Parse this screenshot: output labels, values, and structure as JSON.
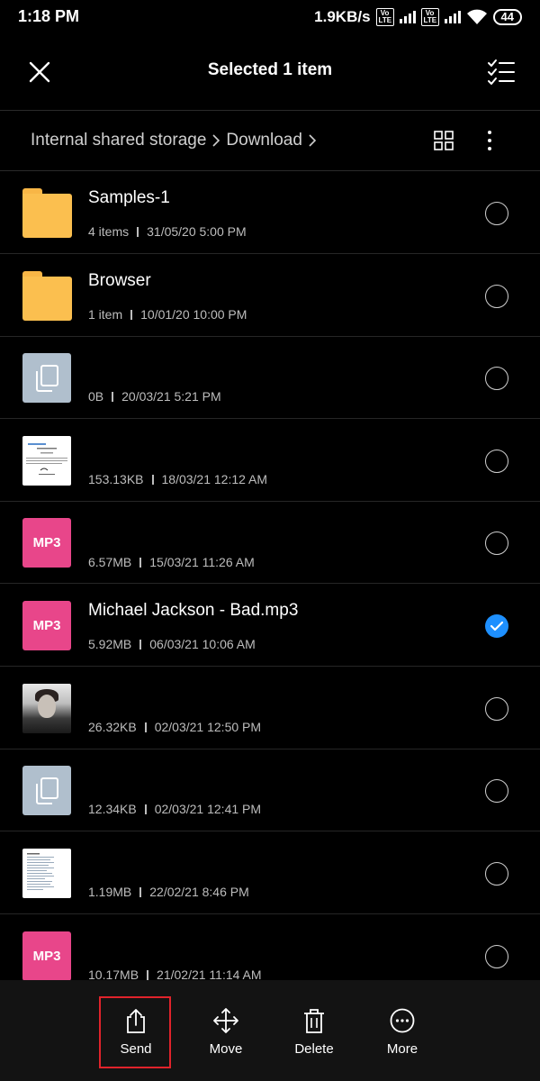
{
  "status_bar": {
    "time": "1:18 PM",
    "speed": "1.9KB/s",
    "volte_label": "Vo LTE",
    "battery": "44"
  },
  "header": {
    "title": "Selected 1 item"
  },
  "breadcrumb": {
    "items": [
      "Internal shared storage",
      "Download"
    ]
  },
  "files": [
    {
      "name": "Samples-1",
      "size": "4 items",
      "date": "31/05/20 5:00 PM",
      "thumb": "folder",
      "checked": false
    },
    {
      "name": "Browser",
      "size": "1 item",
      "date": "10/01/20 10:00 PM",
      "thumb": "folder",
      "checked": false
    },
    {
      "name": "",
      "size": "0B",
      "date": "20/03/21 5:21 PM",
      "thumb": "document-icon",
      "checked": false
    },
    {
      "name": "",
      "size": "153.13KB",
      "date": "18/03/21 12:12 AM",
      "thumb": "certificate-preview",
      "checked": false
    },
    {
      "name": "",
      "size": "6.57MB",
      "date": "15/03/21 11:26 AM",
      "thumb": "mp3",
      "checked": false
    },
    {
      "name": "Michael Jackson - Bad.mp3",
      "size": "5.92MB",
      "date": "06/03/21 10:06 AM",
      "thumb": "mp3",
      "checked": true
    },
    {
      "name": "",
      "size": "26.32KB",
      "date": "02/03/21 12:50 PM",
      "thumb": "photo",
      "checked": false
    },
    {
      "name": "",
      "size": "12.34KB",
      "date": "02/03/21 12:41 PM",
      "thumb": "document-icon",
      "checked": false
    },
    {
      "name": "",
      "size": "1.19MB",
      "date": "22/02/21 8:46 PM",
      "thumb": "document-preview",
      "checked": false
    },
    {
      "name": "",
      "size": "10.17MB",
      "date": "21/02/21 11:14 AM",
      "thumb": "mp3",
      "checked": false
    }
  ],
  "mp3_label": "MP3",
  "actions": {
    "send": "Send",
    "move": "Move",
    "delete": "Delete",
    "more": "More"
  },
  "colors": {
    "background": "#000000",
    "folder": "#fbbf4f",
    "mp3": "#e8468a",
    "check": "#1e90ff",
    "highlight": "#e0232b"
  }
}
